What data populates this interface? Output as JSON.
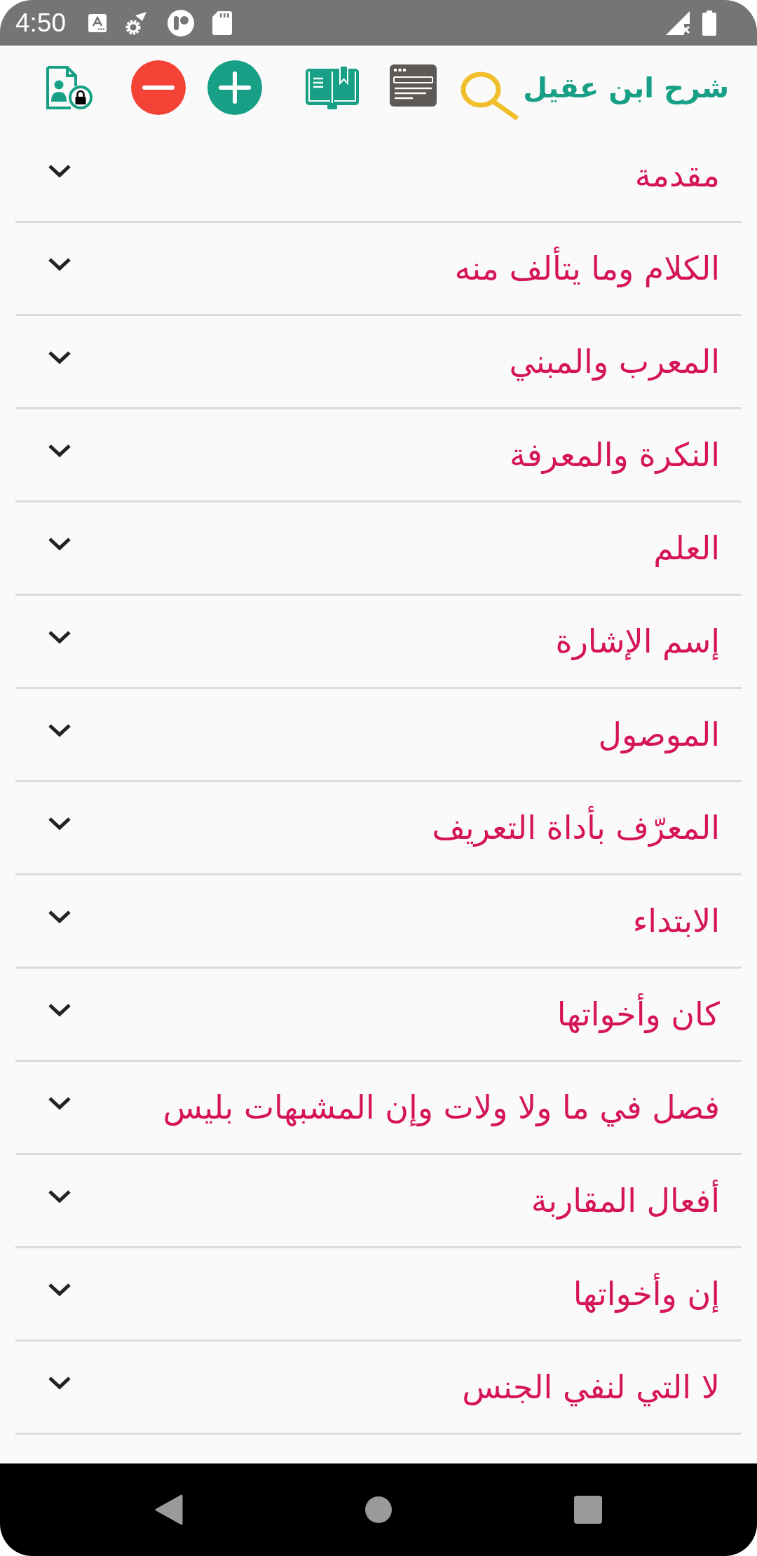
{
  "status_bar": {
    "time": "4:50"
  },
  "toolbar": {
    "title": "شرح ابن عقيل"
  },
  "chapters": [
    {
      "title": "مقدمة",
      "expanded": false
    },
    {
      "title": "الكلام وما يتألف منه",
      "expanded": false
    },
    {
      "title": "المعرب والمبني",
      "expanded": false
    },
    {
      "title": "النكرة والمعرفة",
      "expanded": false
    },
    {
      "title": "العلم",
      "expanded": false
    },
    {
      "title": "إسم الإشارة",
      "expanded": false
    },
    {
      "title": "الموصول",
      "expanded": false
    },
    {
      "title": "المعرّف بأداة التعريف",
      "expanded": false
    },
    {
      "title": "الابتداء",
      "expanded": false
    },
    {
      "title": "كان وأخواتها",
      "expanded": false
    },
    {
      "title": "فصل في ما ولا ولات وإن المشبهات بليس",
      "expanded": false
    },
    {
      "title": "أفعال المقاربة",
      "expanded": false
    },
    {
      "title": "إن وأخواتها",
      "expanded": false
    },
    {
      "title": "لا التي لنفي الجنس",
      "expanded": false
    }
  ]
}
